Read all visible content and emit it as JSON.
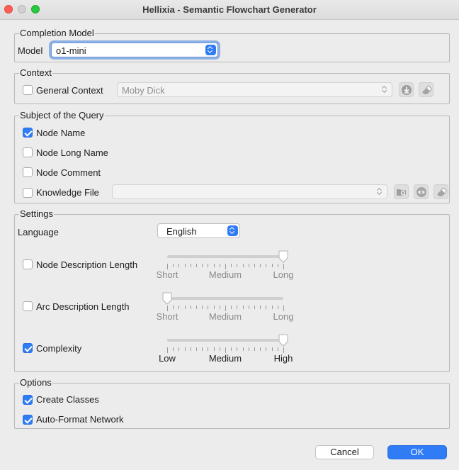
{
  "window": {
    "title": "Hellixia - Semantic Flowchart Generator"
  },
  "completion_model": {
    "legend": "Completion Model",
    "model_label": "Model",
    "model_value": "o1-mini"
  },
  "context": {
    "legend": "Context",
    "general_context_label": "General Context",
    "general_context_checked": false,
    "context_value": "Moby Dick"
  },
  "subject": {
    "legend": "Subject of the Query",
    "items": [
      {
        "label": "Node Name",
        "checked": true
      },
      {
        "label": "Node Long Name",
        "checked": false
      },
      {
        "label": "Node Comment",
        "checked": false
      }
    ],
    "knowledge_file_label": "Knowledge File",
    "knowledge_file_checked": false,
    "knowledge_file_value": ""
  },
  "settings": {
    "legend": "Settings",
    "language_label": "Language",
    "language_value": "English",
    "sliders": [
      {
        "label": "Node Description Length",
        "checked": false,
        "value": 1.0,
        "ticks": [
          "Short",
          "Medium",
          "Long"
        ],
        "active": false
      },
      {
        "label": "Arc Description Length",
        "checked": false,
        "value": 0.0,
        "ticks": [
          "Short",
          "Medium",
          "Long"
        ],
        "active": false
      },
      {
        "label": "Complexity",
        "checked": true,
        "value": 1.0,
        "ticks": [
          "Low",
          "Medium",
          "High"
        ],
        "active": true
      }
    ]
  },
  "options": {
    "legend": "Options",
    "items": [
      {
        "label": "Create Classes",
        "checked": true
      },
      {
        "label": "Auto-Format Network",
        "checked": true
      }
    ]
  },
  "buttons": {
    "cancel": "Cancel",
    "ok": "OK"
  },
  "colors": {
    "accent": "#2f7cf6",
    "window_bg": "#ececec"
  }
}
